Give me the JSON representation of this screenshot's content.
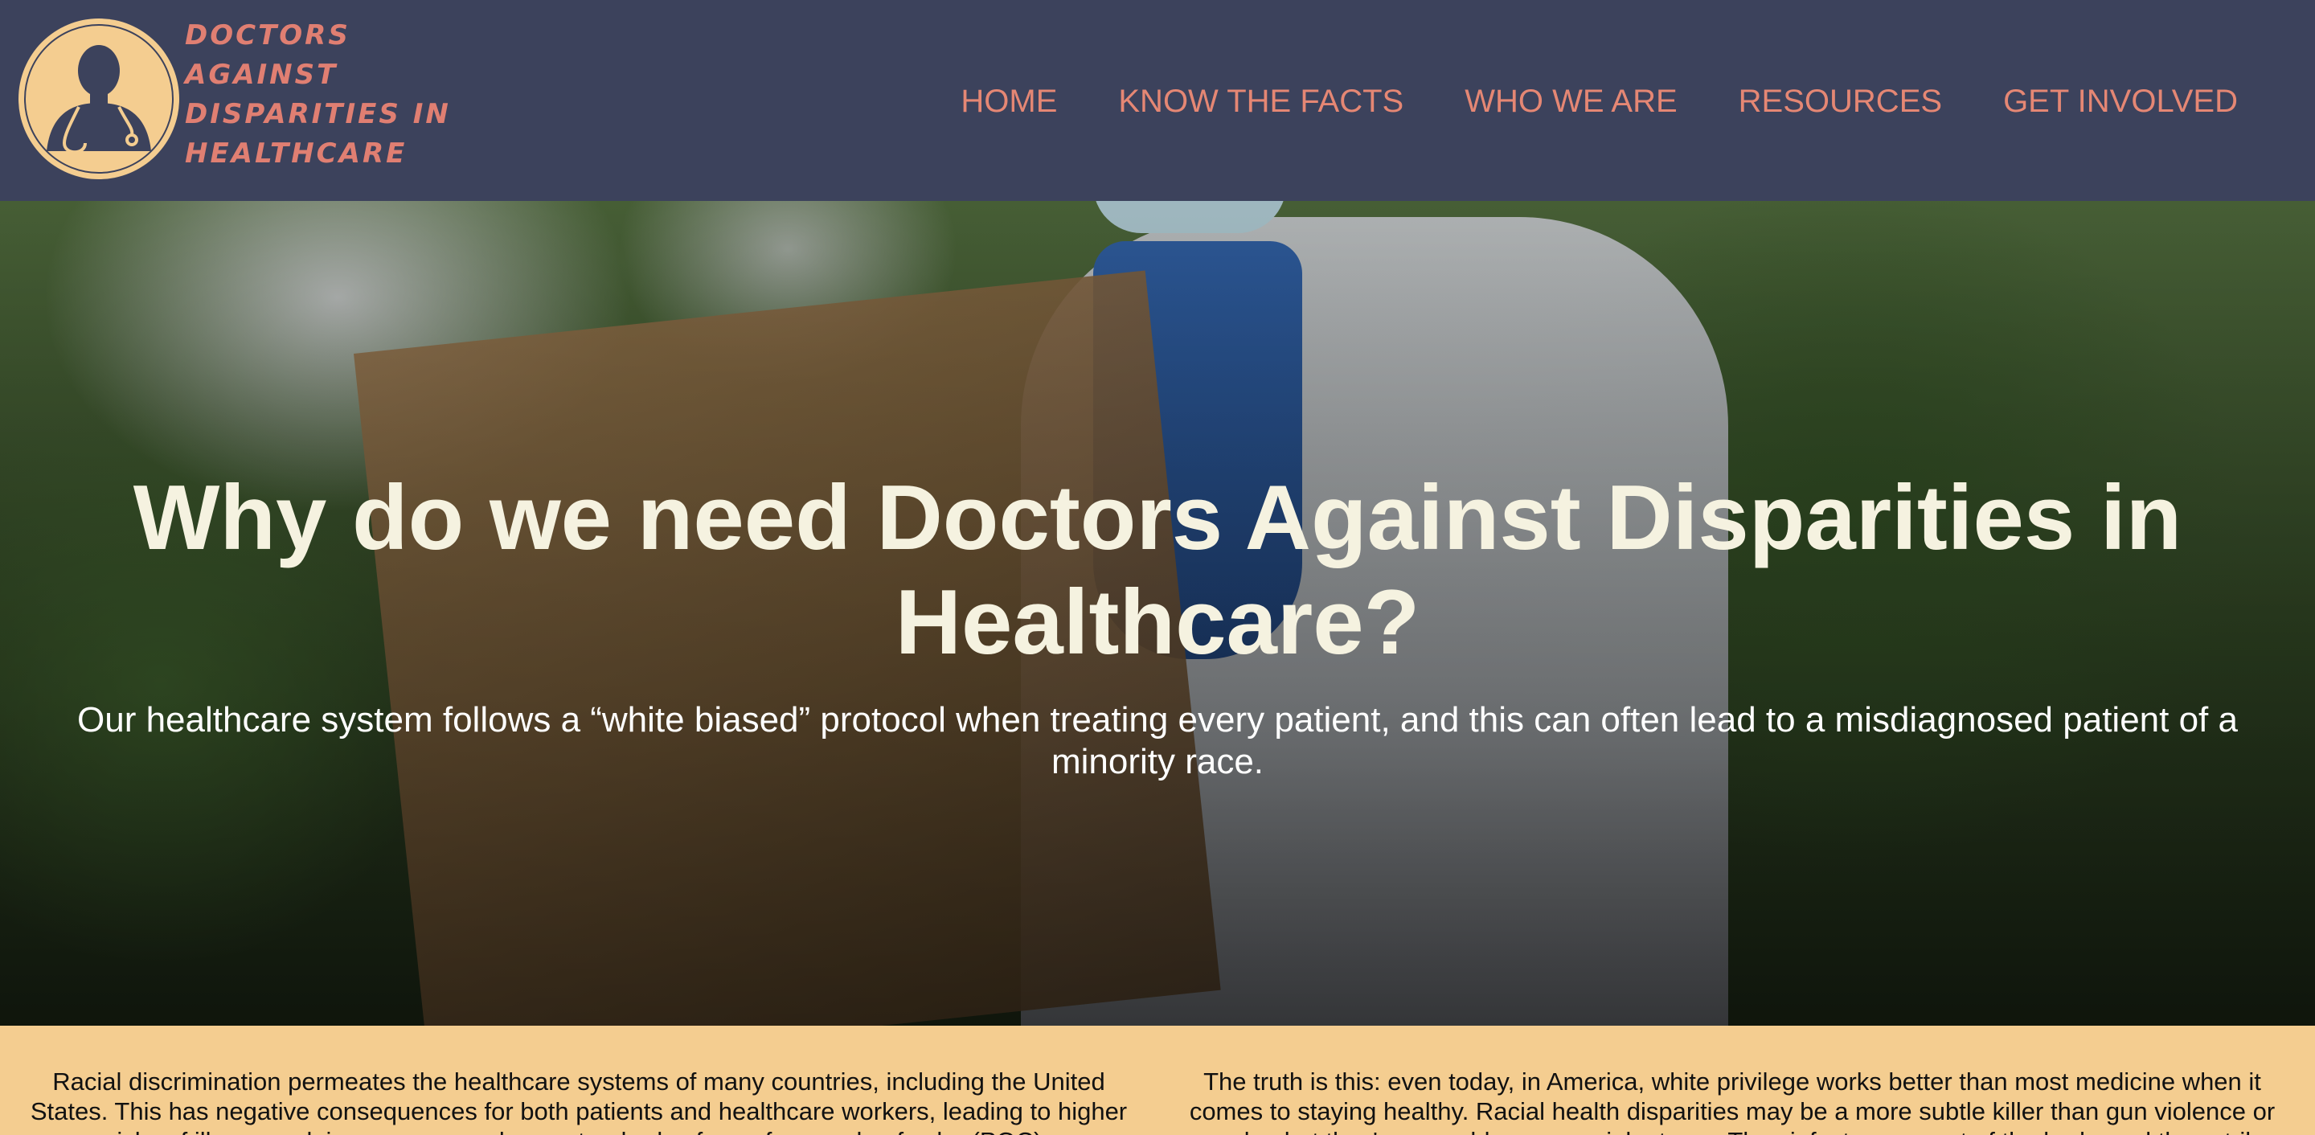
{
  "header": {
    "logo_icon": "doctor-with-stethoscope-icon",
    "logo_lines": [
      "Doctors",
      "Against",
      "Disparities in",
      "Healthcare"
    ],
    "nav": [
      {
        "label": "HOME"
      },
      {
        "label": "KNOW THE FACTS"
      },
      {
        "label": "WHO WE ARE"
      },
      {
        "label": "RESOURCES"
      },
      {
        "label": "GET INVOLVED"
      }
    ]
  },
  "hero": {
    "title": "Why do we need Doctors Against Disparities in Healthcare?",
    "subtitle": "Our healthcare system follows a “white biased” protocol when treating every patient, and this can often lead to a misdiagnosed patient of a minority race."
  },
  "intro": {
    "left": "Racial discrimination permeates the healthcare systems of many countries, including the United States. This has negative consequences for both patients and healthcare workers, leading to higher risks of illness and, in some cases, lower standards of care for people of color (POC).",
    "right": "The truth is this: even today, in America, white privilege works better than most medicine when it comes to staying healthy. Racial health disparities may be a more subtle killer than gun violence or murder, but they're arguably a more violent one. They infect every part of the body, and they strike"
  },
  "colors": {
    "header_bg": "#3c425c",
    "nav_text": "#e58774",
    "logo_ring": "#f4cd90",
    "hero_title": "#f5f2e0",
    "band_bg": "#f4cd90"
  }
}
